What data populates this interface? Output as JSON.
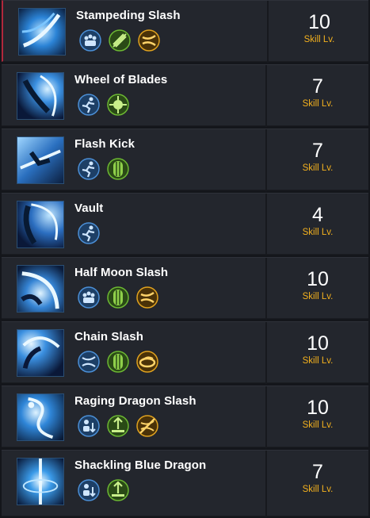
{
  "skills": [
    {
      "name": "Stampeding Slash",
      "level": "10",
      "level_label": "Skill Lv.",
      "icon": "stampeding-slash-icon",
      "selected": true,
      "tags": [
        "super-armor-icon",
        "weak-point-icon",
        "counter-icon"
      ]
    },
    {
      "name": "Wheel of Blades",
      "level": "7",
      "level_label": "Skill Lv.",
      "icon": "wheel-of-blades-icon",
      "selected": false,
      "tags": [
        "mobility-icon",
        "head-attack-icon"
      ]
    },
    {
      "name": "Flash Kick",
      "level": "7",
      "level_label": "Skill Lv.",
      "icon": "flash-kick-icon",
      "selected": false,
      "tags": [
        "mobility-icon",
        "stagger-icon"
      ]
    },
    {
      "name": "Vault",
      "level": "4",
      "level_label": "Skill Lv.",
      "icon": "vault-icon",
      "selected": false,
      "tags": [
        "mobility-icon"
      ]
    },
    {
      "name": "Half Moon Slash",
      "level": "10",
      "level_label": "Skill Lv.",
      "icon": "half-moon-slash-icon",
      "selected": false,
      "tags": [
        "super-armor-icon",
        "stagger-icon",
        "counter-icon"
      ]
    },
    {
      "name": "Chain Slash",
      "level": "10",
      "level_label": "Skill Lv.",
      "icon": "chain-slash-icon",
      "selected": false,
      "tags": [
        "mobility-icon",
        "stagger-icon",
        "push-icon"
      ]
    },
    {
      "name": "Raging Dragon Slash",
      "level": "10",
      "level_label": "Skill Lv.",
      "icon": "raging-dragon-slash-icon",
      "selected": false,
      "tags": [
        "down-attack-icon",
        "stand-up-attack-icon",
        "counter-crossed-icon"
      ]
    },
    {
      "name": "Shackling Blue Dragon",
      "level": "7",
      "level_label": "Skill Lv.",
      "icon": "shackling-blue-dragon-icon",
      "selected": false,
      "tags": [
        "down-attack-icon",
        "stand-up-attack-icon"
      ]
    }
  ],
  "colors": {
    "row_bg": "#23262d",
    "level_label": "#f2b01e",
    "selected_accent": "#b0283c",
    "tag_blue": "#3f7fc4",
    "tag_green": "#5fa82c",
    "tag_gold": "#d99a1c"
  }
}
